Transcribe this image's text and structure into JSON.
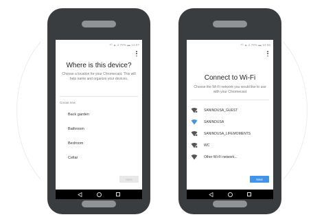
{
  "colors": {
    "phone_body": "#3a3d3f",
    "accent": "#4294e8",
    "nav_bar": "#000000",
    "disabled_button": "#e8e8e8"
  },
  "left_phone": {
    "status_text": "⁴ᴳ ▲.ıl 78% ▬ 14:07",
    "title": "Where is this device?",
    "subtitle": "Choose a location for your Chromecast. This will help name and organize your devices.",
    "section_label": "Create new",
    "rooms": [
      "Back garden",
      "Bathroom",
      "Bedroom",
      "Cellar"
    ],
    "next_label": "Next",
    "next_state": "disabled"
  },
  "right_phone": {
    "status_text": "⁴ᴳ ▲.ıl 78% ▬ 14:06",
    "title": "Connect to Wi-Fi",
    "subtitle": "Choose the Wi-Fi network you would like to use with your Chromecast",
    "networks": [
      {
        "name": "SANINDUSA_GUEST",
        "icon": "wifi-locked-icon",
        "selected": false
      },
      {
        "name": "SANINDUSA",
        "icon": "wifi-signal-icon",
        "selected": true
      },
      {
        "name": "SANINDUSA_LIFEMOMENTS",
        "icon": "wifi-locked-icon",
        "selected": false
      },
      {
        "name": "WC",
        "icon": "wifi-locked-icon",
        "selected": false
      },
      {
        "name": "Other Wi-Fi network...",
        "icon": "wifi-add-icon",
        "selected": false
      }
    ],
    "next_label": "Next",
    "next_state": "active"
  }
}
